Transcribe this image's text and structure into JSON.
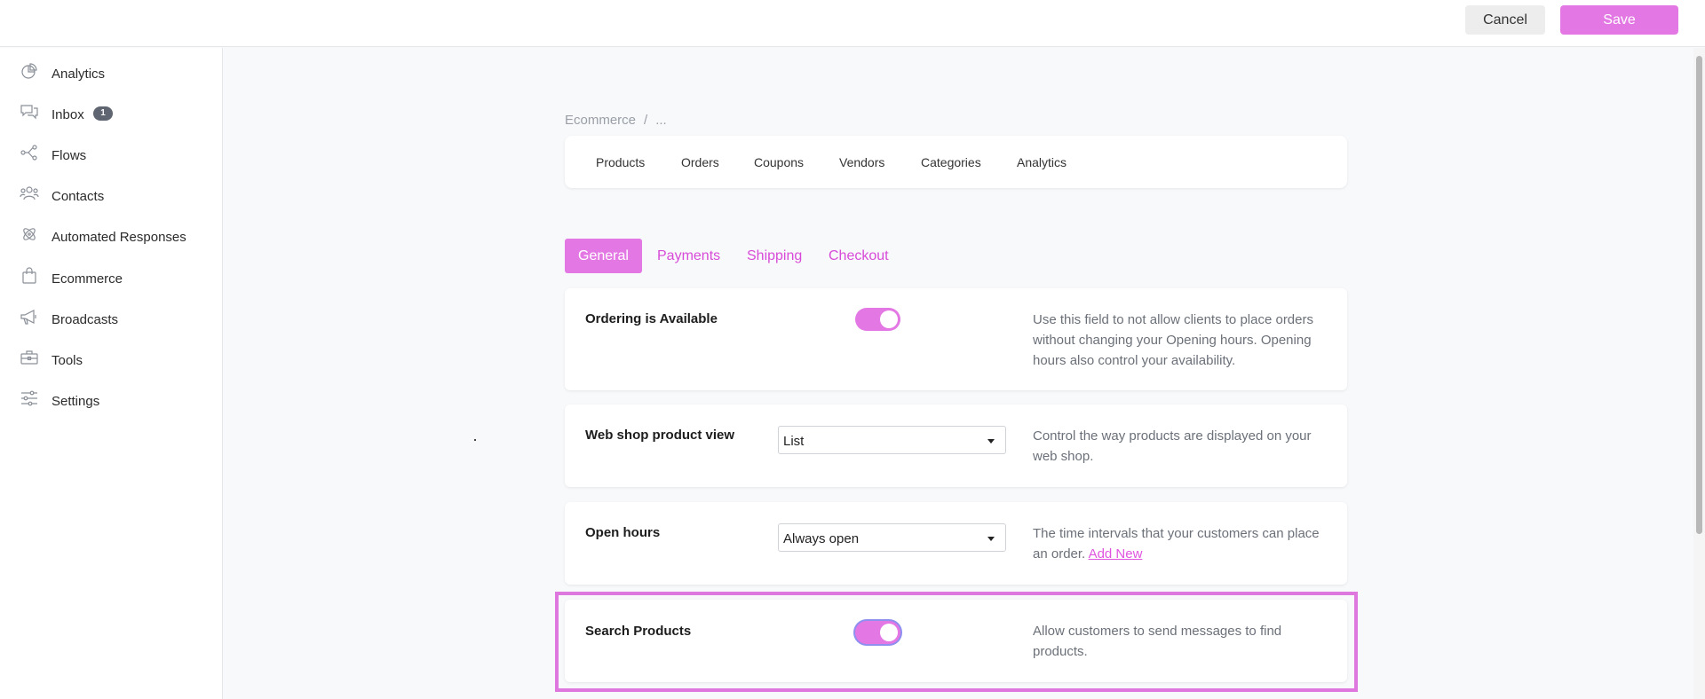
{
  "header": {
    "cancel_label": "Cancel",
    "save_label": "Save"
  },
  "sidebar": {
    "items": [
      {
        "label": "Analytics",
        "icon": "analytics-icon"
      },
      {
        "label": "Inbox",
        "icon": "inbox-icon",
        "badge": "1"
      },
      {
        "label": "Flows",
        "icon": "flows-icon"
      },
      {
        "label": "Contacts",
        "icon": "contacts-icon"
      },
      {
        "label": "Automated Responses",
        "icon": "automated-responses-icon"
      },
      {
        "label": "Ecommerce",
        "icon": "shopping-bag-icon"
      },
      {
        "label": "Broadcasts",
        "icon": "megaphone-icon"
      },
      {
        "label": "Tools",
        "icon": "toolbox-icon"
      },
      {
        "label": "Settings",
        "icon": "sliders-icon"
      }
    ]
  },
  "breadcrumb": {
    "root": "Ecommerce",
    "separator": "/",
    "current": "..."
  },
  "main_tabs": [
    "Products",
    "Orders",
    "Coupons",
    "Vendors",
    "Categories",
    "Analytics"
  ],
  "sub_tabs": {
    "items": [
      "General",
      "Payments",
      "Shipping",
      "Checkout"
    ],
    "active": "General"
  },
  "settings": {
    "ordering": {
      "label": "Ordering is Available",
      "enabled": true,
      "description": "Use this field to not allow clients to place orders without changing your Opening hours. Opening hours also control your availability."
    },
    "product_view": {
      "label": "Web shop product view",
      "value": "List",
      "description": "Control the way products are displayed on your web shop."
    },
    "open_hours": {
      "label": "Open hours",
      "value": "Always open",
      "description": "The time intervals that your customers can place an order.",
      "link": "Add New"
    },
    "search_products": {
      "label": "Search Products",
      "enabled": true,
      "description": "Allow customers to send messages to find products."
    }
  },
  "colors": {
    "accent": "#e377e3",
    "highlight": "#de77de",
    "badge": "#5f6672"
  }
}
